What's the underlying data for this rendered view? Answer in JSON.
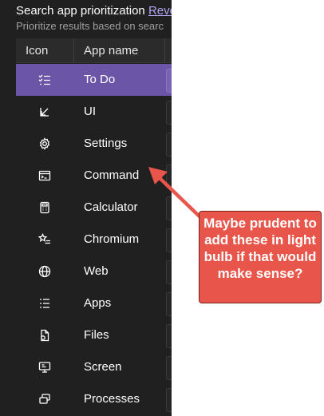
{
  "header": {
    "title": "Search app prioritization ",
    "link": "Reve",
    "subtitle": "Prioritize results based on searc"
  },
  "table": {
    "columns": [
      "Icon",
      "App name"
    ],
    "rows": [
      {
        "icon": "checklist-icon",
        "name": "To Do",
        "selected": true
      },
      {
        "icon": "arrow-down-left-icon",
        "name": "UI",
        "selected": false
      },
      {
        "icon": "gear-icon",
        "name": "Settings",
        "selected": false
      },
      {
        "icon": "terminal-icon",
        "name": "Command",
        "selected": false
      },
      {
        "icon": "calculator-icon",
        "name": "Calculator",
        "selected": false
      },
      {
        "icon": "star-list-icon",
        "name": "Chromium",
        "selected": false
      },
      {
        "icon": "globe-icon",
        "name": "Web",
        "selected": false
      },
      {
        "icon": "list-icon",
        "name": "Apps",
        "selected": false
      },
      {
        "icon": "file-icon",
        "name": "Files",
        "selected": false
      },
      {
        "icon": "monitor-icon",
        "name": "Screen",
        "selected": false
      },
      {
        "icon": "windows-stack-icon",
        "name": "Processes",
        "selected": false
      }
    ]
  },
  "annotation": {
    "text": "Maybe prudent to add these in light bulb if that would make sense?",
    "color": "#e8554a"
  },
  "colors": {
    "panel_bg": "#202020",
    "selected_row": "#6b55a6",
    "link": "#b3a6f2"
  }
}
